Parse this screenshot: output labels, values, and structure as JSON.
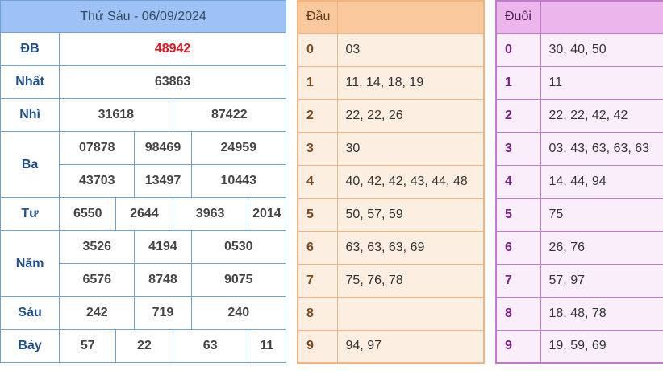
{
  "results": {
    "title": "Thứ Sáu - 06/09/2024",
    "rows": {
      "db": {
        "label": "ĐB",
        "values": [
          "48942"
        ]
      },
      "nhat": {
        "label": "Nhất",
        "values": [
          "63863"
        ]
      },
      "nhi": {
        "label": "Nhì",
        "values": [
          "31618",
          "87422"
        ]
      },
      "ba": {
        "label": "Ba",
        "values": [
          "07878",
          "98469",
          "24959",
          "43703",
          "13497",
          "10443"
        ]
      },
      "tu": {
        "label": "Tư",
        "values": [
          "6550",
          "2644",
          "3963",
          "2014"
        ]
      },
      "nam": {
        "label": "Năm",
        "values": [
          "3526",
          "4194",
          "0530",
          "6576",
          "8748",
          "9075"
        ]
      },
      "sau": {
        "label": "Sáu",
        "values": [
          "242",
          "719",
          "240"
        ]
      },
      "bay": {
        "label": "Bảy",
        "values": [
          "57",
          "22",
          "63",
          "11"
        ]
      }
    }
  },
  "heads": {
    "title": "Đầu",
    "rows": [
      {
        "digit": "0",
        "values": "03"
      },
      {
        "digit": "1",
        "values": "11, 14, 18, 19"
      },
      {
        "digit": "2",
        "values": "22, 22, 26"
      },
      {
        "digit": "3",
        "values": "30"
      },
      {
        "digit": "4",
        "values": "40, 42, 42, 43, 44, 48"
      },
      {
        "digit": "5",
        "values": "50, 57, 59"
      },
      {
        "digit": "6",
        "values": "63, 63, 63, 69"
      },
      {
        "digit": "7",
        "values": "75, 76, 78"
      },
      {
        "digit": "8",
        "values": ""
      },
      {
        "digit": "9",
        "values": "94, 97"
      }
    ]
  },
  "tails": {
    "title": "Đuôi",
    "rows": [
      {
        "digit": "0",
        "values": "30, 40, 50"
      },
      {
        "digit": "1",
        "values": "11"
      },
      {
        "digit": "2",
        "values": "22, 22, 42, 42"
      },
      {
        "digit": "3",
        "values": "03, 43, 63, 63, 63"
      },
      {
        "digit": "4",
        "values": "14, 44, 94"
      },
      {
        "digit": "5",
        "values": "75"
      },
      {
        "digit": "6",
        "values": "26, 76"
      },
      {
        "digit": "7",
        "values": "57, 97"
      },
      {
        "digit": "8",
        "values": "18, 48, 78"
      },
      {
        "digit": "9",
        "values": "19, 59, 69"
      }
    ]
  }
}
